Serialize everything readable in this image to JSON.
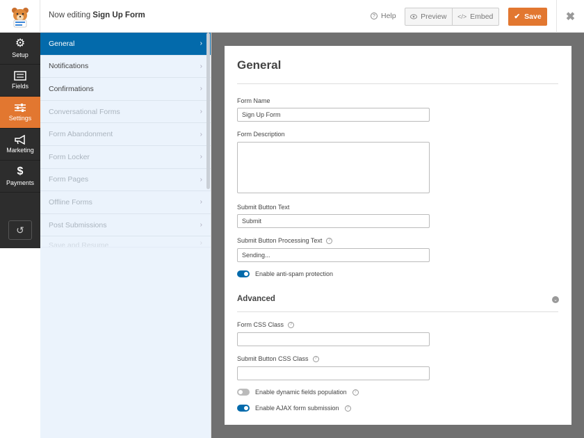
{
  "header": {
    "editing_prefix": "Now editing",
    "form_name": "Sign Up Form",
    "help_label": "Help",
    "preview_label": "Preview",
    "embed_label": "Embed",
    "save_label": "Save"
  },
  "colors": {
    "accent": "#e27730",
    "primary": "#036aab",
    "nav_bg": "#2d2d2d",
    "submenu_bg": "#ebf3fc"
  },
  "iconnav": {
    "items": [
      {
        "label": "Setup",
        "icon": "gear-icon"
      },
      {
        "label": "Fields",
        "icon": "fields-icon"
      },
      {
        "label": "Settings",
        "icon": "sliders-icon"
      },
      {
        "label": "Marketing",
        "icon": "megaphone-icon"
      },
      {
        "label": "Payments",
        "icon": "dollar-icon"
      }
    ],
    "active": "Settings"
  },
  "submenu": {
    "items": [
      {
        "label": "General"
      },
      {
        "label": "Notifications"
      },
      {
        "label": "Confirmations"
      },
      {
        "label": "Conversational Forms"
      },
      {
        "label": "Form Abandonment"
      },
      {
        "label": "Form Locker"
      },
      {
        "label": "Form Pages"
      },
      {
        "label": "Offline Forms"
      },
      {
        "label": "Post Submissions"
      },
      {
        "label": "Save and Resume"
      }
    ],
    "active": "General"
  },
  "panel": {
    "title": "General",
    "form_name_label": "Form Name",
    "form_name_value": "Sign Up Form",
    "form_description_label": "Form Description",
    "submit_text_label": "Submit Button Text",
    "submit_text_value": "Submit",
    "processing_text_label": "Submit Button Processing Text",
    "processing_text_value": "Sending...",
    "antispam_label": "Enable anti-spam protection",
    "antispam_on": true,
    "advanced_title": "Advanced",
    "css_class_label": "Form CSS Class",
    "css_class_value": "",
    "submit_css_label": "Submit Button CSS Class",
    "submit_css_value": "",
    "dynamic_label": "Enable dynamic fields population",
    "dynamic_on": false,
    "ajax_label": "Enable AJAX form submission",
    "ajax_on": true
  }
}
